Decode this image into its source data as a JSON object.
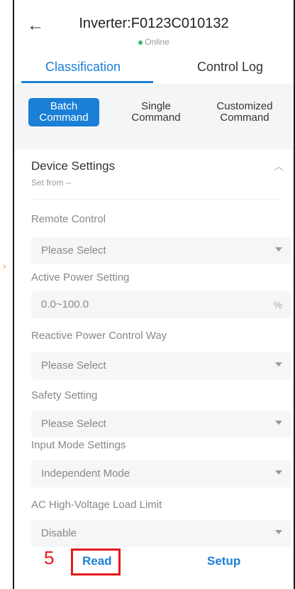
{
  "header": {
    "title": "Inverter:F0123C010132",
    "status": "Online",
    "back_icon": "arrow-left-icon"
  },
  "tabs": [
    {
      "label": "Classification",
      "active": true
    },
    {
      "label": "Control Log",
      "active": false
    }
  ],
  "segments": [
    {
      "line1": "Batch",
      "line2": "Command",
      "active": true
    },
    {
      "line1": "Single",
      "line2": "Command",
      "active": false
    },
    {
      "line1": "Customized",
      "line2": "Command",
      "active": false
    }
  ],
  "card": {
    "title": "Device Settings",
    "subtitle": "Set from --",
    "collapse_icon": "chevron-up-icon"
  },
  "fields": [
    {
      "label": "Remote Control",
      "value": "Please Select",
      "type": "select"
    },
    {
      "label": "Active Power Setting",
      "value": "0.0~100.0",
      "type": "input",
      "unit": "%"
    },
    {
      "label": "Reactive Power Control Way",
      "value": "Please Select",
      "type": "select"
    },
    {
      "label": "Safety Setting",
      "value": "Please Select",
      "type": "select"
    },
    {
      "label": "Input Mode Settings",
      "value": "Independent Mode",
      "type": "select"
    },
    {
      "label": "AC High-Voltage Load Limit",
      "value": "Disable",
      "type": "select"
    }
  ],
  "footer": {
    "step_number": "5",
    "read_label": "Read",
    "setup_label": "Setup"
  },
  "colors": {
    "accent": "#1a7fd6",
    "online": "#3cb371",
    "annotation": "#e51a1a"
  }
}
